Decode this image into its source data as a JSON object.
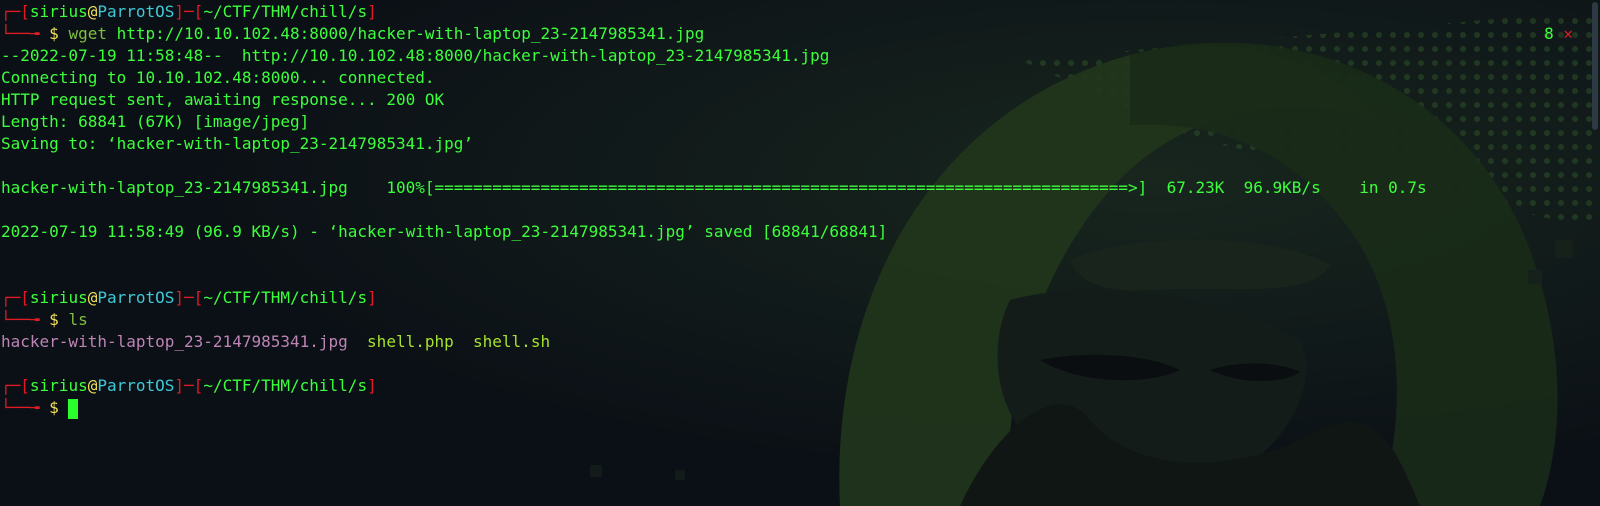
{
  "prompt": {
    "user": "sirius",
    "at": "@",
    "host": "ParrotOS",
    "path": "~/CTF/THM/chill/s",
    "dollar": "$",
    "box_top_left": "┌─[",
    "box_sep": "]─[",
    "box_close": "]",
    "box_bottom": "└──╼ "
  },
  "commands": {
    "wget_cmd": "wget",
    "wget_arg": "http://10.10.102.48:8000/hacker-with-laptop_23-2147985341.jpg",
    "ls_cmd": "ls"
  },
  "status": {
    "exit_code": "8",
    "fail_icon": "✕"
  },
  "output": {
    "wget": [
      "--2022-07-19 11:58:48--  http://10.10.102.48:8000/hacker-with-laptop_23-2147985341.jpg",
      "Connecting to 10.10.102.48:8000... connected.",
      "HTTP request sent, awaiting response... 200 OK",
      "Length: 68841 (67K) [image/jpeg]",
      "Saving to: ‘hacker-with-laptop_23-2147985341.jpg’"
    ],
    "progress": "hacker-with-laptop_23-2147985341.jpg    100%[========================================================================>]  67.23K  96.9KB/s    in 0.7s",
    "saved": "2022-07-19 11:58:49 (96.9 KB/s) - ‘hacker-with-laptop_23-2147985341.jpg’ saved [68841/68841]",
    "ls_files": [
      {
        "name": "hacker-with-laptop_23-2147985341.jpg",
        "type": "image"
      },
      {
        "name": "shell.php",
        "type": "script"
      },
      {
        "name": "shell.sh",
        "type": "script"
      }
    ]
  },
  "colors": {
    "background": "#0b1016",
    "prompt_frame": "#e01b24",
    "output_text": "#3cff3c",
    "host": "#3ec9d6",
    "dollar": "#f0e05a",
    "cursor": "#2bff2b"
  },
  "icons": {
    "background": "hooded-hacker-wallpaper-icon",
    "cursor": "block-cursor-icon"
  }
}
